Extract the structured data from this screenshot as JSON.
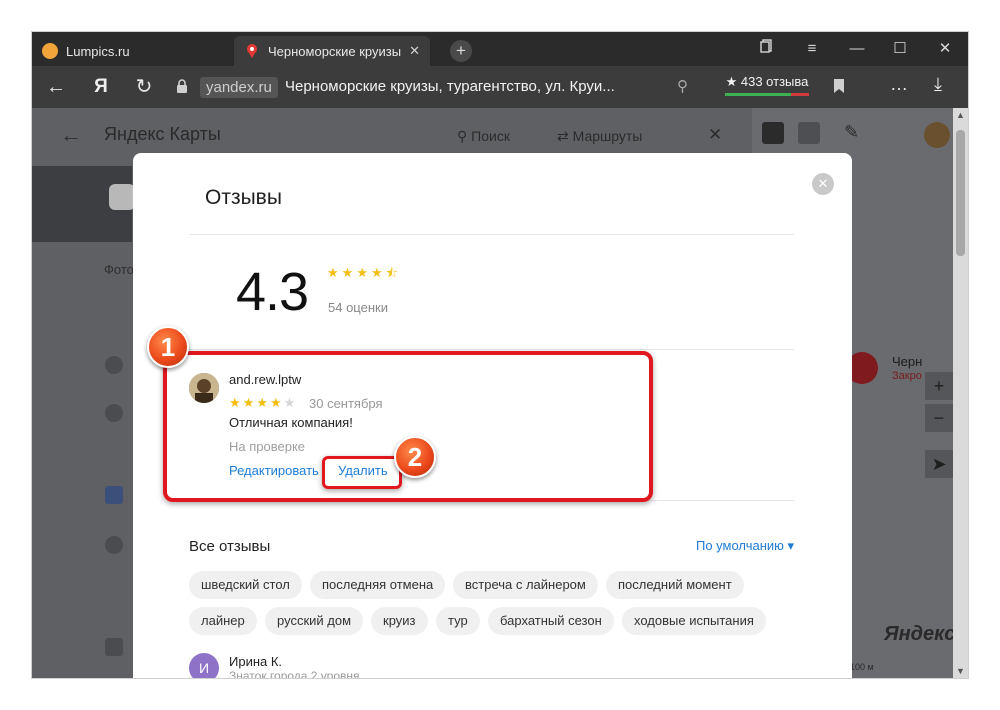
{
  "browser": {
    "tabs": [
      {
        "title": "Lumpics.ru",
        "active": false
      },
      {
        "title": "Черноморские круизы",
        "active": true
      }
    ],
    "new_tab": "+",
    "window_controls": [
      "bookmarks-manager-icon",
      "menu-icon",
      "minimize-icon",
      "maximize-icon",
      "close-icon"
    ],
    "window_glyphs": {
      "menu": "≡",
      "minimize": "—",
      "maximize": "☐",
      "close": "✕"
    },
    "address": {
      "domain": "yandex.ru",
      "page_title": "Черноморские круизы, турагентство, ул. Круи...",
      "reviews_badge": "★ 433 отзыва",
      "reviews_positive_fraction": 0.78
    }
  },
  "yandex_maps": {
    "logo": "Яндекс Карты",
    "search": "Поиск",
    "routes": "Маршруты",
    "photo_label": "Фото",
    "map_place_name": "Черн",
    "map_place_status": "Закро",
    "watermark": "Яндекс",
    "scale": "100 м"
  },
  "reviews_modal": {
    "title": "Отзывы",
    "rating": "4.3",
    "rating_stars": 4.5,
    "ratings_count": "54 оценки",
    "my_review": {
      "author": "and.rew.lptw",
      "stars": 4,
      "date": "30 сентября",
      "text": "Отличная компания!",
      "status": "На проверке",
      "edit_label": "Редактировать",
      "delete_label": "Удалить"
    },
    "all_reviews_title": "Все отзывы",
    "sort_label": "По умолчанию ▾",
    "tags_row1": [
      "шведский стол",
      "последняя отмена",
      "встреча с лайнером",
      "последний момент"
    ],
    "tags_row2": [
      "лайнер",
      "русский дом",
      "круиз",
      "тур",
      "бархатный сезон",
      "ходовые испытания"
    ],
    "next_review": {
      "avatar_letter": "И",
      "author": "Ирина К.",
      "subtitle": "Знаток города 2 уровня"
    }
  },
  "annotations": {
    "step1": "1",
    "step2": "2",
    "color": "#e0171f"
  },
  "colors": {
    "star": "#f4be11",
    "link": "#1f7cd6"
  }
}
